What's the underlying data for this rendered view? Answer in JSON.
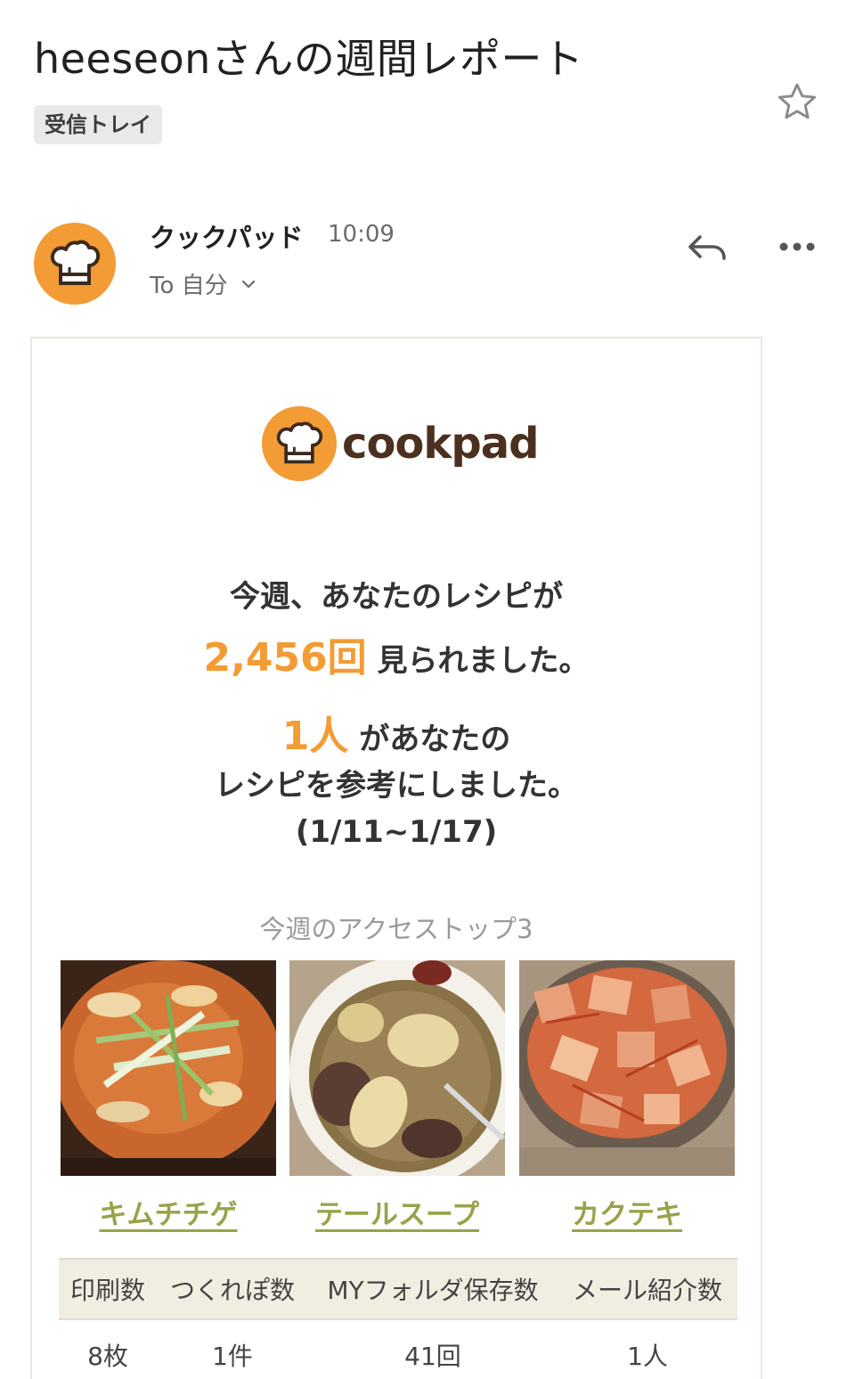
{
  "email": {
    "subject": "heeseonさんの週間レポート",
    "label": "受信トレイ",
    "sender": "クックパッド",
    "time": "10:09",
    "recipient": "To 自分"
  },
  "body": {
    "brand": "cookpad",
    "views_line1": "今週、あなたのレシピが",
    "views_count": "2,456回",
    "views_suffix": "見られました。",
    "ref_count": "1人",
    "ref_suffix": "があなたの",
    "ref_line2": "レシピを参考にしました。",
    "period": "(1/11~1/17)",
    "top3_title": "今週のアクセストップ3",
    "recipes": [
      {
        "name": "キムチチゲ"
      },
      {
        "name": "テールスープ"
      },
      {
        "name": "カクテキ"
      }
    ],
    "stats": {
      "headers": [
        "印刷数",
        "つくれぽ数",
        "MYフォルダ保存数",
        "メール紹介数"
      ],
      "values": [
        "8枚",
        "1件",
        "41回",
        "1人"
      ]
    }
  },
  "colors": {
    "accent_orange": "#f39b34",
    "recipe_link_green": "#98a34a",
    "brand_brown": "#4b3020"
  },
  "icons": [
    "star-icon",
    "reply-icon",
    "more-icon",
    "chevron-down-icon",
    "chef-hat-icon"
  ]
}
